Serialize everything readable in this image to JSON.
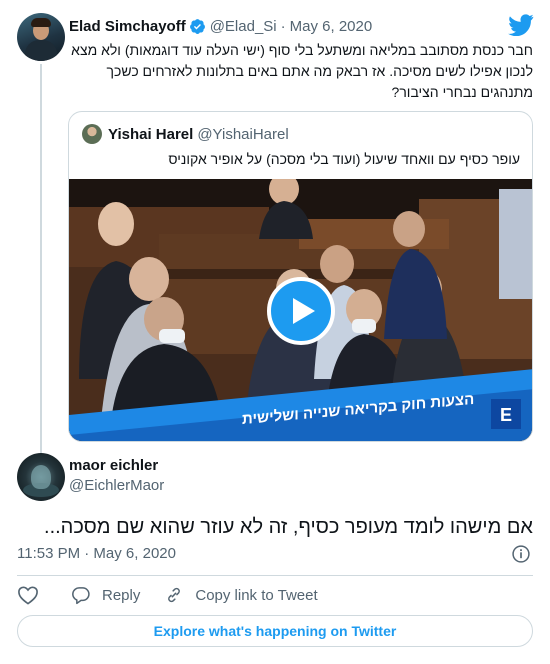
{
  "tweet": {
    "author_name": "Elad Simchayoff",
    "author_handle": "@Elad_Si",
    "separator": "·",
    "date": "May 6, 2020",
    "text": "חבר כנסת מסתובב במליאה ומשתעל בלי סוף (ישי העלה עוד דוגמאות) ולא מצא לנכון אפילו לשים מסיכה. אז רבאק מה אתם באים בתלונות לאזרחים כשכך מתנהגים נבחרי הציבור?",
    "avatar_icon": "profile-photo",
    "verified_icon": "verified-badge-icon",
    "logo_icon": "twitter-bird-icon"
  },
  "quoted": {
    "author_name": "Yishai Harel",
    "author_handle": "@YishaiHarel",
    "text": "עופר כסיף עם וואחד שיעול (ועוד בלי מסכה) על אופיר אקוניס",
    "video": {
      "play_icon": "play-icon",
      "banner_text": "הצעות חוק בקריאה שנייה ושלישית",
      "accent": "#1d9bf0"
    }
  },
  "reply": {
    "author_name": "maor eichler",
    "author_handle": "@EichlerMaor",
    "text": "אם מישהו לומד מעופר כסיף, זה לא עוזר שהוא שם מסכה...",
    "timestamp": "11:53 PM · May 6, 2020",
    "info_icon": "info-icon"
  },
  "actions": {
    "like_label": "",
    "reply_label": "Reply",
    "copy_label": "Copy link to Tweet"
  },
  "footer": {
    "explore_label": "Explore what's happening on Twitter"
  },
  "colors": {
    "brand": "#1d9bf0",
    "text": "#0f1419",
    "secondary": "#536471",
    "border": "#cfd9de"
  }
}
